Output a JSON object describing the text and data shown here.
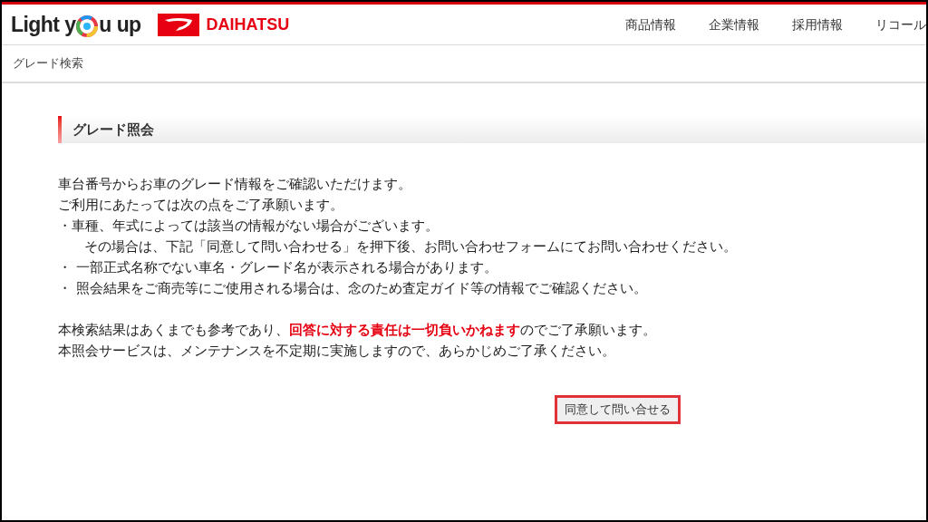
{
  "header": {
    "logo": {
      "before": "Light y",
      "after": "u up"
    },
    "brand": "DAIHATSU",
    "nav": [
      "商品情報",
      "企業情報",
      "採用情報",
      "リコール"
    ]
  },
  "breadcrumb": "グレード検索",
  "heading": "グレード照会",
  "intro": [
    {
      "kind": "plain",
      "text": "車台番号からお車のグレード情報をご確認いただけます。"
    },
    {
      "kind": "plain",
      "text": "ご利用にあたっては次の点をご了承願います。"
    },
    {
      "kind": "plain",
      "text": "・車種、年式によっては該当の情報がない場合がございます。"
    },
    {
      "kind": "indent",
      "text": "その場合は、下記「同意して問い合わせる」を押下後、お問い合わせフォームにてお問い合わせください。"
    },
    {
      "kind": "plain",
      "text": "・ 一部正式名称でない車名・グレード名が表示される場合があります。"
    },
    {
      "kind": "plain",
      "text": "・ 照会結果をご商売等にご使用される場合は、念のため査定ガイド等の情報でご確認ください。"
    }
  ],
  "notice": [
    {
      "before": "本検索結果はあくまでも参考であり、",
      "emphasis": "回答に対する責任は一切負いかねます",
      "after": "のでご了承願います。"
    },
    {
      "before": "本照会サービスは、メンテナンスを不定期に実施しますので、あらかじめご了承ください。"
    }
  ],
  "button": "同意して問い合せる"
}
